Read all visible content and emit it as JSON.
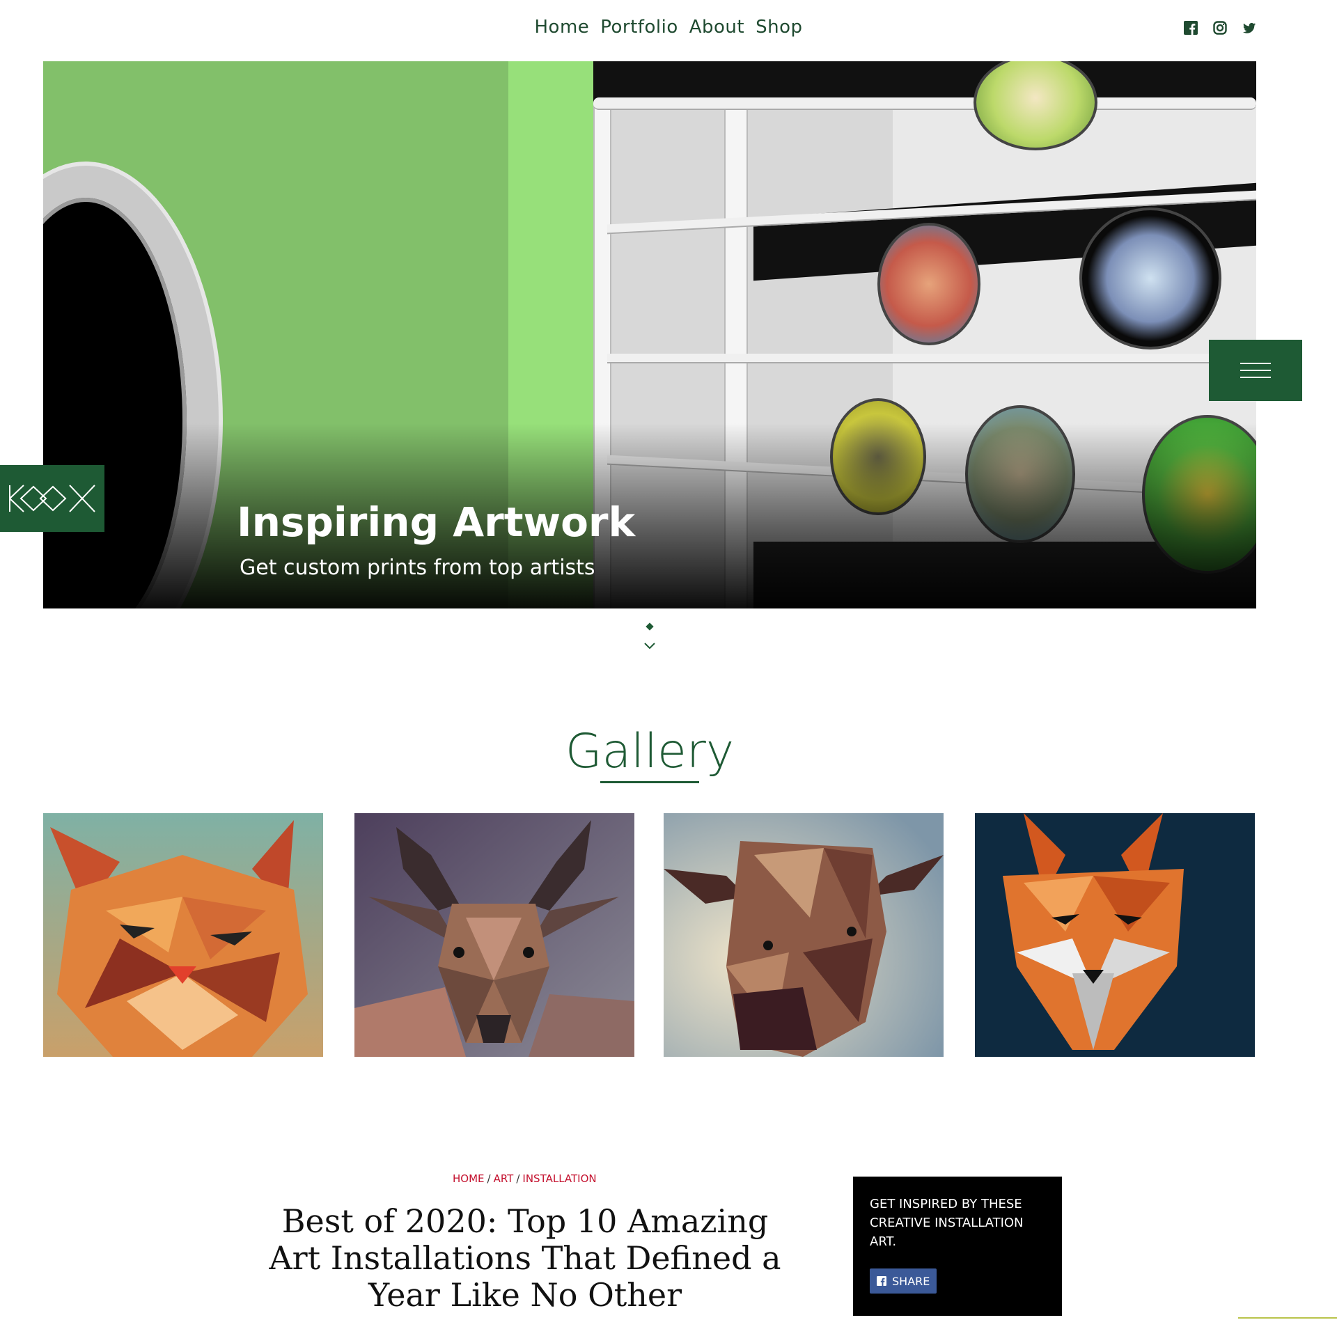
{
  "nav": {
    "items": [
      {
        "label": "Home"
      },
      {
        "label": "Portfolio"
      },
      {
        "label": "About"
      },
      {
        "label": "Shop"
      }
    ],
    "social": [
      "facebook-icon",
      "instagram-icon",
      "twitter-icon"
    ]
  },
  "hero": {
    "title": "Inspiring Artwork",
    "subtitle": "Get custom prints from top artists",
    "logo": "KOOX"
  },
  "gallery": {
    "title": "Gallery",
    "items": [
      {
        "name": "cat-lowpoly-artwork"
      },
      {
        "name": "deer-lowpoly-artwork"
      },
      {
        "name": "bull-lowpoly-artwork"
      },
      {
        "name": "fox-lowpoly-artwork"
      }
    ]
  },
  "article": {
    "breadcrumb": [
      "HOME",
      "ART",
      "INSTALLATION"
    ],
    "title": "Best of 2020: Top 10 Amazing Art Installations That Defined a Year Like No Other"
  },
  "promo": {
    "text": "GET INSPIRED BY THESE CREATIVE INSTALLATION ART.",
    "share_label": "SHARE"
  },
  "colors": {
    "brand_green": "#1e5a34",
    "hero_green": "#82c06a",
    "breadcrumb_red": "#c4122f",
    "facebook_blue": "#3b5998"
  }
}
